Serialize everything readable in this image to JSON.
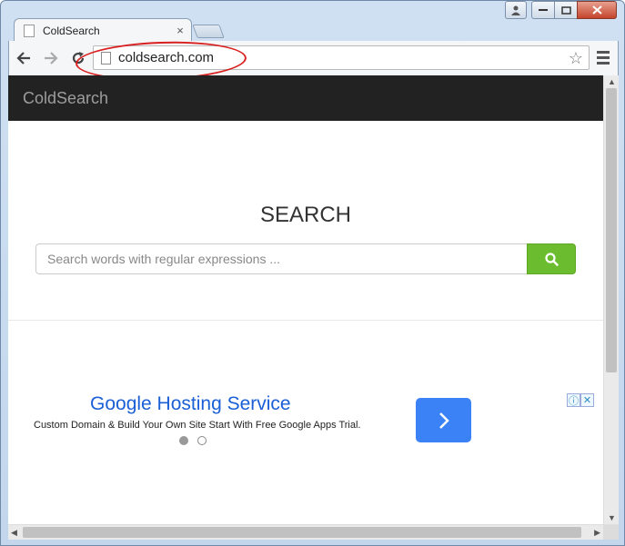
{
  "browser": {
    "tab_title": "ColdSearch",
    "tab_close": "×",
    "url": "coldsearch.com",
    "star": "☆"
  },
  "page": {
    "brand": "ColdSearch",
    "heading": "SEARCH",
    "search_placeholder": "Search words with regular expressions ...",
    "accent": "#6bbd2f",
    "nav_bg": "#222222"
  },
  "ad": {
    "title": "Google Hosting Service",
    "description": "Custom Domain & Build Your Own Site Start With Free Google Apps Trial.",
    "info_icon": "ⓘ",
    "close_icon": "✕",
    "button_color": "#3b82f6"
  },
  "scroll": {
    "up": "▲",
    "down": "▼",
    "left": "◀",
    "right": "▶"
  }
}
